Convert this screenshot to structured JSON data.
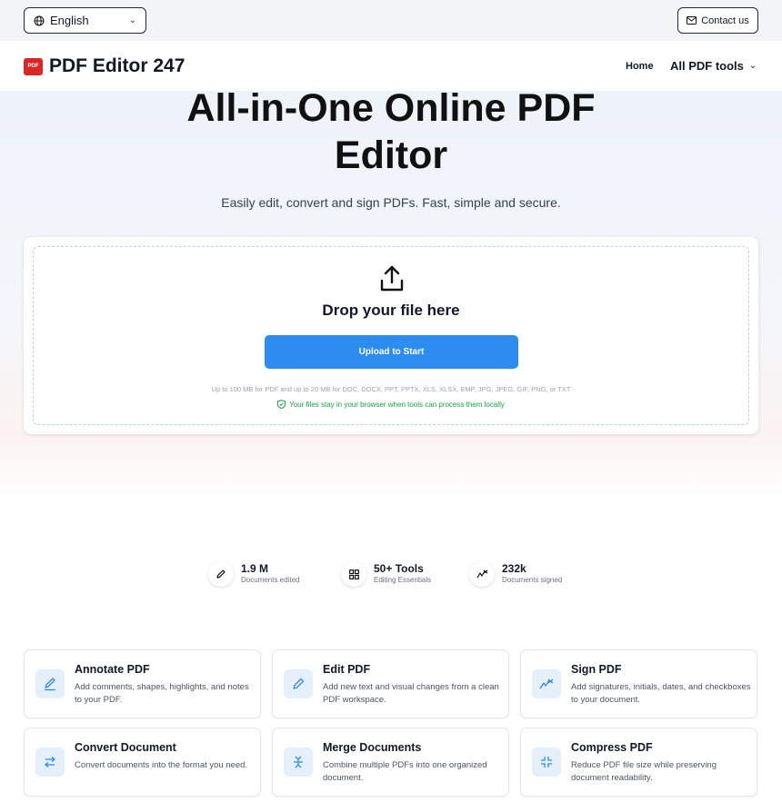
{
  "topbar": {
    "language": "English",
    "contact": "Contact us"
  },
  "nav": {
    "logo_badge": "PDF",
    "logo_text": "PDF Editor 247",
    "home": "Home",
    "all_tools": "All PDF tools"
  },
  "hero": {
    "title_line1": "All-in-One Online PDF",
    "title_line2": "Editor",
    "subtitle": "Easily edit, convert and sign PDFs. Fast, simple and secure."
  },
  "upload": {
    "drop_title": "Drop your file here",
    "button": "Upload to Start",
    "limits": "Up to 100 MB for PDF and up to 20 MB for DOC, DOCX, PPT, PPTX, XLS, XLSX, BMP, JPG, JPEG, GIF, PNG, or TXT",
    "local_note": "Your files stay in your browser when tools can process them locally"
  },
  "stats": [
    {
      "value": "1.9 M",
      "label": "Documents edited",
      "icon": "pencil-icon"
    },
    {
      "value": "50+ Tools",
      "label": "Editing Essentials",
      "icon": "grid-icon"
    },
    {
      "value": "232k",
      "label": "Documents signed",
      "icon": "signature-icon"
    }
  ],
  "tools": [
    {
      "title": "Annotate PDF",
      "desc": "Add comments, shapes, highlights, and notes to your PDF.",
      "icon": "annotate-icon"
    },
    {
      "title": "Edit PDF",
      "desc": "Add new text and visual changes from a clean PDF workspace.",
      "icon": "edit-icon"
    },
    {
      "title": "Sign PDF",
      "desc": "Add signatures, initials, dates, and checkboxes to your document.",
      "icon": "sign-icon"
    },
    {
      "title": "Convert Document",
      "desc": "Convert documents into the format you need.",
      "icon": "convert-icon"
    },
    {
      "title": "Merge Documents",
      "desc": "Combine multiple PDFs into one organized document.",
      "icon": "merge-icon"
    },
    {
      "title": "Compress PDF",
      "desc": "Reduce PDF file size while preserving document readability.",
      "icon": "compress-icon"
    }
  ],
  "colors": {
    "accent": "#2d8cf0",
    "logo_red": "#dc2626",
    "secure_green": "#16a34a",
    "icon_bg": "#e6f0fb"
  }
}
